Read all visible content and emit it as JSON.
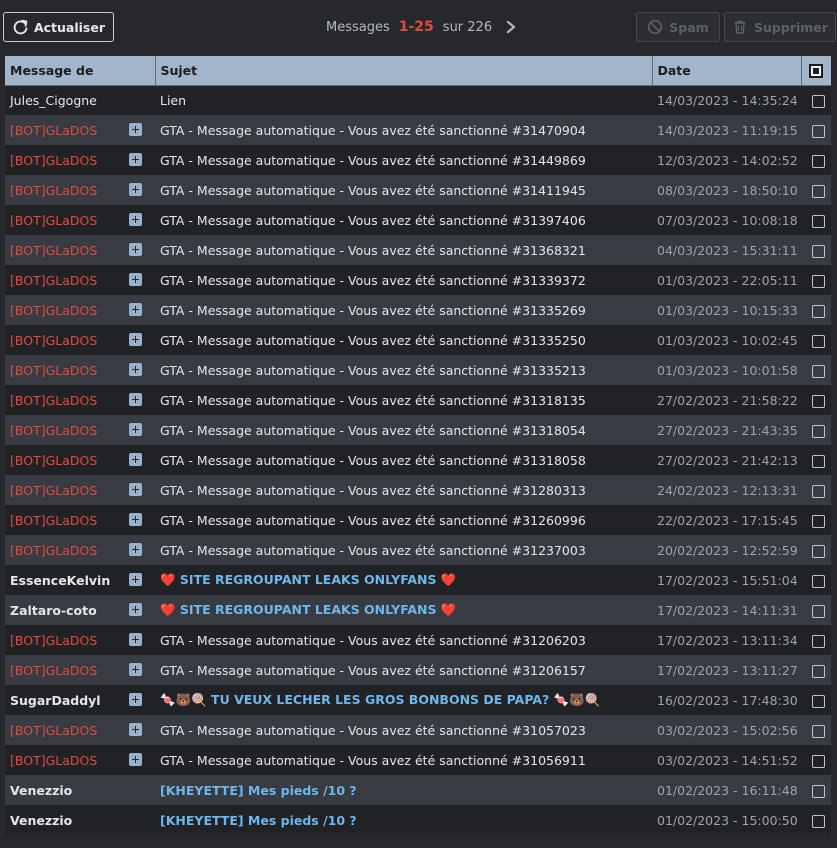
{
  "toolbar": {
    "refresh_label": "Actualiser",
    "pager_prefix": "Messages",
    "pager_range": "1-25",
    "pager_suffix": "sur 226",
    "spam_label": "Spam",
    "delete_label": "Supprimer"
  },
  "columns": {
    "author": "Message de",
    "subject": "Sujet",
    "date": "Date"
  },
  "colors": {
    "header_bg": "#a2b5cb",
    "bot_name": "#e04a3f",
    "link_subject": "#6fb6ec",
    "pager_range": "#e04a3f"
  },
  "messages": [
    {
      "author": "Jules_Cigogne",
      "kind": "normal",
      "expand": false,
      "subject": "Lien",
      "date": "14/03/2023 - 14:35:24"
    },
    {
      "author": "[BOT]GLaDOS",
      "kind": "bot",
      "expand": true,
      "subject": "GTA - Message automatique - Vous avez été sanctionné #31470904",
      "date": "14/03/2023 - 11:19:15"
    },
    {
      "author": "[BOT]GLaDOS",
      "kind": "bot",
      "expand": true,
      "subject": "GTA - Message automatique - Vous avez été sanctionné #31449869",
      "date": "12/03/2023 - 14:02:52"
    },
    {
      "author": "[BOT]GLaDOS",
      "kind": "bot",
      "expand": true,
      "subject": "GTA - Message automatique - Vous avez été sanctionné #31411945",
      "date": "08/03/2023 - 18:50:10"
    },
    {
      "author": "[BOT]GLaDOS",
      "kind": "bot",
      "expand": true,
      "subject": "GTA - Message automatique - Vous avez été sanctionné #31397406",
      "date": "07/03/2023 - 10:08:18"
    },
    {
      "author": "[BOT]GLaDOS",
      "kind": "bot",
      "expand": true,
      "subject": "GTA - Message automatique - Vous avez été sanctionné #31368321",
      "date": "04/03/2023 - 15:31:11"
    },
    {
      "author": "[BOT]GLaDOS",
      "kind": "bot",
      "expand": true,
      "subject": "GTA - Message automatique - Vous avez été sanctionné #31339372",
      "date": "01/03/2023 - 22:05:11"
    },
    {
      "author": "[BOT]GLaDOS",
      "kind": "bot",
      "expand": true,
      "subject": "GTA - Message automatique - Vous avez été sanctionné #31335269",
      "date": "01/03/2023 - 10:15:33"
    },
    {
      "author": "[BOT]GLaDOS",
      "kind": "bot",
      "expand": true,
      "subject": "GTA - Message automatique - Vous avez été sanctionné #31335250",
      "date": "01/03/2023 - 10:02:45"
    },
    {
      "author": "[BOT]GLaDOS",
      "kind": "bot",
      "expand": true,
      "subject": "GTA - Message automatique - Vous avez été sanctionné #31335213",
      "date": "01/03/2023 - 10:01:58"
    },
    {
      "author": "[BOT]GLaDOS",
      "kind": "bot",
      "expand": true,
      "subject": "GTA - Message automatique - Vous avez été sanctionné #31318135",
      "date": "27/02/2023 - 21:58:22"
    },
    {
      "author": "[BOT]GLaDOS",
      "kind": "bot",
      "expand": true,
      "subject": "GTA - Message automatique - Vous avez été sanctionné #31318054",
      "date": "27/02/2023 - 21:43:35"
    },
    {
      "author": "[BOT]GLaDOS",
      "kind": "bot",
      "expand": true,
      "subject": "GTA - Message automatique - Vous avez été sanctionné #31318058",
      "date": "27/02/2023 - 21:42:13"
    },
    {
      "author": "[BOT]GLaDOS",
      "kind": "bot",
      "expand": true,
      "subject": "GTA - Message automatique - Vous avez été sanctionné #31280313",
      "date": "24/02/2023 - 12:13:31"
    },
    {
      "author": "[BOT]GLaDOS",
      "kind": "bot",
      "expand": true,
      "subject": "GTA - Message automatique - Vous avez été sanctionné #31260996",
      "date": "22/02/2023 - 17:15:45"
    },
    {
      "author": "[BOT]GLaDOS",
      "kind": "bot",
      "expand": true,
      "subject": "GTA - Message automatique - Vous avez été sanctionné #31237003",
      "date": "20/02/2023 - 12:52:59"
    },
    {
      "author": "EssenceKelvin",
      "kind": "strong",
      "expand": true,
      "subject": "❤️ SITE REGROUPANT LEAKS ONLYFANS ❤️",
      "subject_style": "link",
      "date": "17/02/2023 - 15:51:04"
    },
    {
      "author": "Zaltaro-coto",
      "kind": "strong",
      "expand": true,
      "subject": "❤️ SITE REGROUPANT LEAKS ONLYFANS ❤️",
      "subject_style": "link",
      "date": "17/02/2023 - 14:11:31"
    },
    {
      "author": "[BOT]GLaDOS",
      "kind": "bot",
      "expand": true,
      "subject": "GTA - Message automatique - Vous avez été sanctionné #31206203",
      "date": "17/02/2023 - 13:11:34"
    },
    {
      "author": "[BOT]GLaDOS",
      "kind": "bot",
      "expand": true,
      "subject": "GTA - Message automatique - Vous avez été sanctionné #31206157",
      "date": "17/02/2023 - 13:11:27"
    },
    {
      "author": "SugarDaddyl",
      "kind": "strong",
      "expand": true,
      "subject": "🍬🐻🍭 TU VEUX LECHER LES GROS BONBONS DE PAPA? 🍬🐻🍭",
      "subject_style": "link",
      "date": "16/02/2023 - 17:48:30"
    },
    {
      "author": "[BOT]GLaDOS",
      "kind": "bot",
      "expand": true,
      "subject": "GTA - Message automatique - Vous avez été sanctionné #31057023",
      "date": "03/02/2023 - 15:02:56"
    },
    {
      "author": "[BOT]GLaDOS",
      "kind": "bot",
      "expand": true,
      "subject": "GTA - Message automatique - Vous avez été sanctionné #31056911",
      "date": "03/02/2023 - 14:51:52"
    },
    {
      "author": "Venezzio",
      "kind": "strong",
      "expand": false,
      "subject": "[KHEYETTE] Mes pieds /10 ?",
      "subject_style": "link",
      "date": "01/02/2023 - 16:11:48"
    },
    {
      "author": "Venezzio",
      "kind": "strong",
      "expand": false,
      "subject": "[KHEYETTE] Mes pieds /10 ?",
      "subject_style": "link",
      "date": "01/02/2023 - 15:00:50"
    }
  ]
}
